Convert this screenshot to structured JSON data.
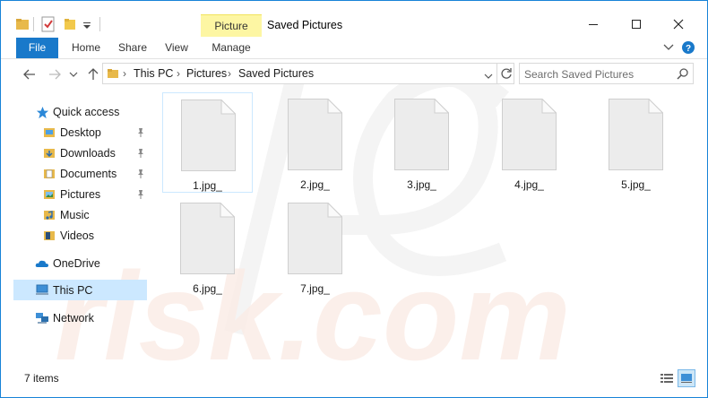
{
  "window": {
    "title": "Saved Pictures",
    "context_tab_group": "Picture Tools"
  },
  "ribbon": {
    "tabs": [
      "File",
      "Home",
      "Share",
      "View",
      "Manage"
    ]
  },
  "address_bar": {
    "crumbs": [
      "This PC",
      "Pictures",
      "Saved Pictures"
    ]
  },
  "search": {
    "placeholder": "Search Saved Pictures"
  },
  "nav_pane": {
    "quick_access": "Quick access",
    "quick_items": [
      {
        "label": "Desktop",
        "icon": "desktop-folder-icon",
        "pinned": true
      },
      {
        "label": "Downloads",
        "icon": "downloads-folder-icon",
        "pinned": true
      },
      {
        "label": "Documents",
        "icon": "documents-folder-icon",
        "pinned": true
      },
      {
        "label": "Pictures",
        "icon": "pictures-folder-icon",
        "pinned": true
      },
      {
        "label": "Music",
        "icon": "music-folder-icon",
        "pinned": false
      },
      {
        "label": "Videos",
        "icon": "videos-folder-icon",
        "pinned": false
      }
    ],
    "onedrive": "OneDrive",
    "this_pc": "This PC",
    "network": "Network"
  },
  "files": [
    {
      "name": "1.jpg_"
    },
    {
      "name": "2.jpg_"
    },
    {
      "name": "3.jpg_"
    },
    {
      "name": "4.jpg_"
    },
    {
      "name": "5.jpg_"
    },
    {
      "name": "6.jpg_"
    },
    {
      "name": "7.jpg_"
    }
  ],
  "status": {
    "item_count": "7 items"
  },
  "colors": {
    "accent": "#1979ca",
    "selected_bg": "#cce8ff",
    "context_tab": "#fdf6a3"
  }
}
